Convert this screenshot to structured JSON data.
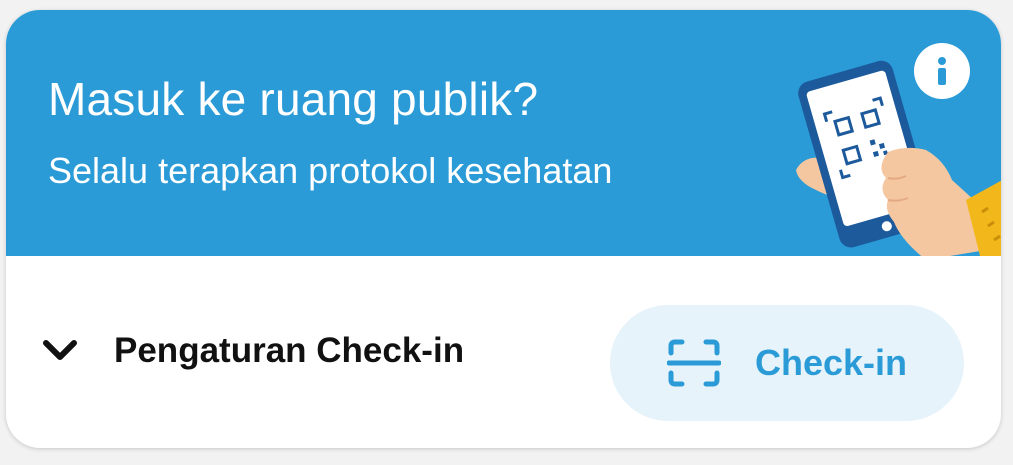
{
  "banner": {
    "title": "Masuk ke ruang publik?",
    "subtitle": "Selalu terapkan protokol kesehatan",
    "illustration_icon": "hand-holding-phone-qr-icon",
    "info_icon": "info-icon"
  },
  "settings": {
    "label": "Pengaturan Check-in",
    "icon": "chevron-down-icon"
  },
  "checkin": {
    "label": "Check-in",
    "icon": "qr-scan-icon"
  },
  "colors": {
    "brand_blue": "#2a9bd7",
    "button_bg": "#e6f3fa",
    "text_dark": "#111111",
    "white": "#ffffff"
  }
}
